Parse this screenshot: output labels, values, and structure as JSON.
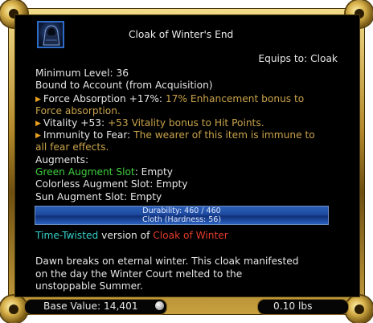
{
  "item": {
    "title": "Cloak of Winter's End",
    "equips_to": "Equips to:  Cloak",
    "minimum_level": "Minimum Level: 36",
    "bound": "Bound to Account (from Acquisition)",
    "effects": [
      {
        "name": "Force Absorption +17%:",
        "desc_line1": "17% Enhancement bonus to",
        "desc_line2": "Force absorption."
      },
      {
        "name": "Vitality +53:",
        "desc_line1": "+53 Vitality bonus to Hit Points."
      },
      {
        "name": "Immunity to Fear:",
        "desc_line1": "The wearer of this item is immune to",
        "desc_line2": "all fear effects."
      }
    ],
    "augments_label": "Augments:",
    "augments": [
      {
        "color_name": "Green Augment Slot",
        "rest": ": Empty"
      },
      {
        "color_name": "Colorless Augment Slot",
        "rest": ": Empty"
      },
      {
        "color_name": "Sun Augment Slot",
        "rest": ": Empty"
      }
    ],
    "durability": "Durability: 460 / 460",
    "material": "Cloth (Hardness: 56)",
    "twist": {
      "time_twisted": "Time-Twisted",
      "version_of": " version of ",
      "original": "Cloak of Winter"
    },
    "flavor_line1": "Dawn breaks on eternal winter. This cloak manifested",
    "flavor_line2": "on the day the Winter Court melted to the",
    "flavor_line3": "unstoppable Summer.",
    "base_value": "Base Value: 14,401",
    "weight": "0.10 lbs"
  },
  "icons": {
    "item_icon": "hooded-cloak-icon",
    "arrow_icon": "triangle-right-icon",
    "coin_icon": "platinum-coin-icon"
  },
  "colors": {
    "gold_text": "#c8a24a",
    "green_augment": "#3fcf3f",
    "time_twisted": "#35d0c8",
    "original_item": "#e23b2b"
  }
}
